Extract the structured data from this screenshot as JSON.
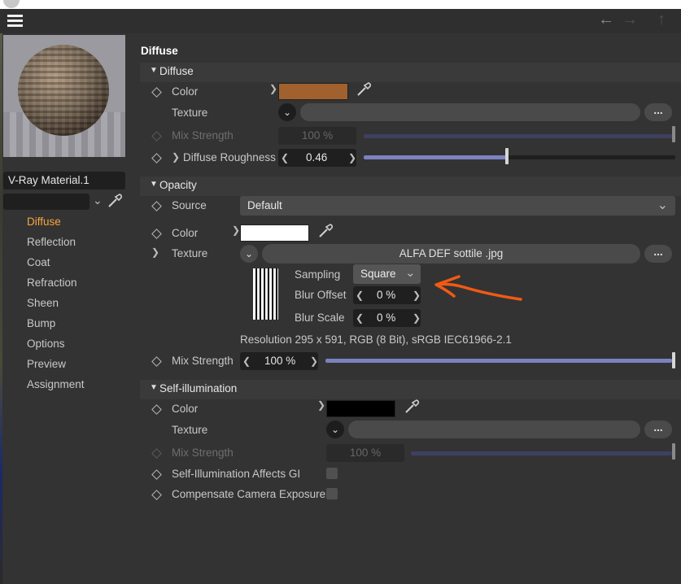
{
  "window": {
    "menu_icon": "hamburger-icon",
    "nav_icons": [
      "arrow-left-icon",
      "arrow-right-icon",
      "arrow-up-icon"
    ]
  },
  "material": {
    "name": "V-Ray Material.1",
    "preview_icon": "material-sphere-preview"
  },
  "sidebar": {
    "items": [
      {
        "label": "Diffuse",
        "active": true
      },
      {
        "label": "Reflection"
      },
      {
        "label": "Coat"
      },
      {
        "label": "Refraction"
      },
      {
        "label": "Sheen"
      },
      {
        "label": "Bump"
      },
      {
        "label": "Options"
      },
      {
        "label": "Preview"
      },
      {
        "label": "Assignment"
      }
    ]
  },
  "page_title": "Diffuse",
  "diffuse": {
    "section": "Diffuse",
    "color_label": "Color",
    "color_value": "#a0612e",
    "texture_label": "Texture",
    "texture_more": "...",
    "mix_strength_label": "Mix Strength",
    "mix_strength_value": "100 %",
    "mix_strength_level": 1.0,
    "roughness_label": "Diffuse Roughness",
    "roughness_value": "0.46",
    "roughness_level": 0.46
  },
  "opacity": {
    "section": "Opacity",
    "source_label": "Source",
    "source_value": "Default",
    "color_label": "Color",
    "color_value": "#ffffff",
    "texture_label": "Texture",
    "texture_file": "ALFA DEF sottile .jpg",
    "texture_more": "...",
    "sampling_label": "Sampling",
    "sampling_value": "Square",
    "blur_offset_label": "Blur Offset",
    "blur_offset_value": "0 %",
    "blur_scale_label": "Blur Scale",
    "blur_scale_value": "0 %",
    "resolution": "Resolution 295 x 591, RGB (8 Bit), sRGB IEC61966-2.1",
    "mix_strength_label": "Mix Strength",
    "mix_strength_value": "100 %",
    "mix_strength_level": 1.0
  },
  "self_illumination": {
    "section": "Self-illumination",
    "color_label": "Color",
    "color_value": "#000000",
    "texture_label": "Texture",
    "texture_more": "...",
    "mix_strength_label": "Mix Strength",
    "mix_strength_value": "100 %",
    "mix_strength_level": 1.0,
    "affects_gi_label": "Self-Illumination Affects GI",
    "compensate_label": "Compensate Camera Exposure"
  },
  "annotation": {
    "color": "#f05a14"
  }
}
